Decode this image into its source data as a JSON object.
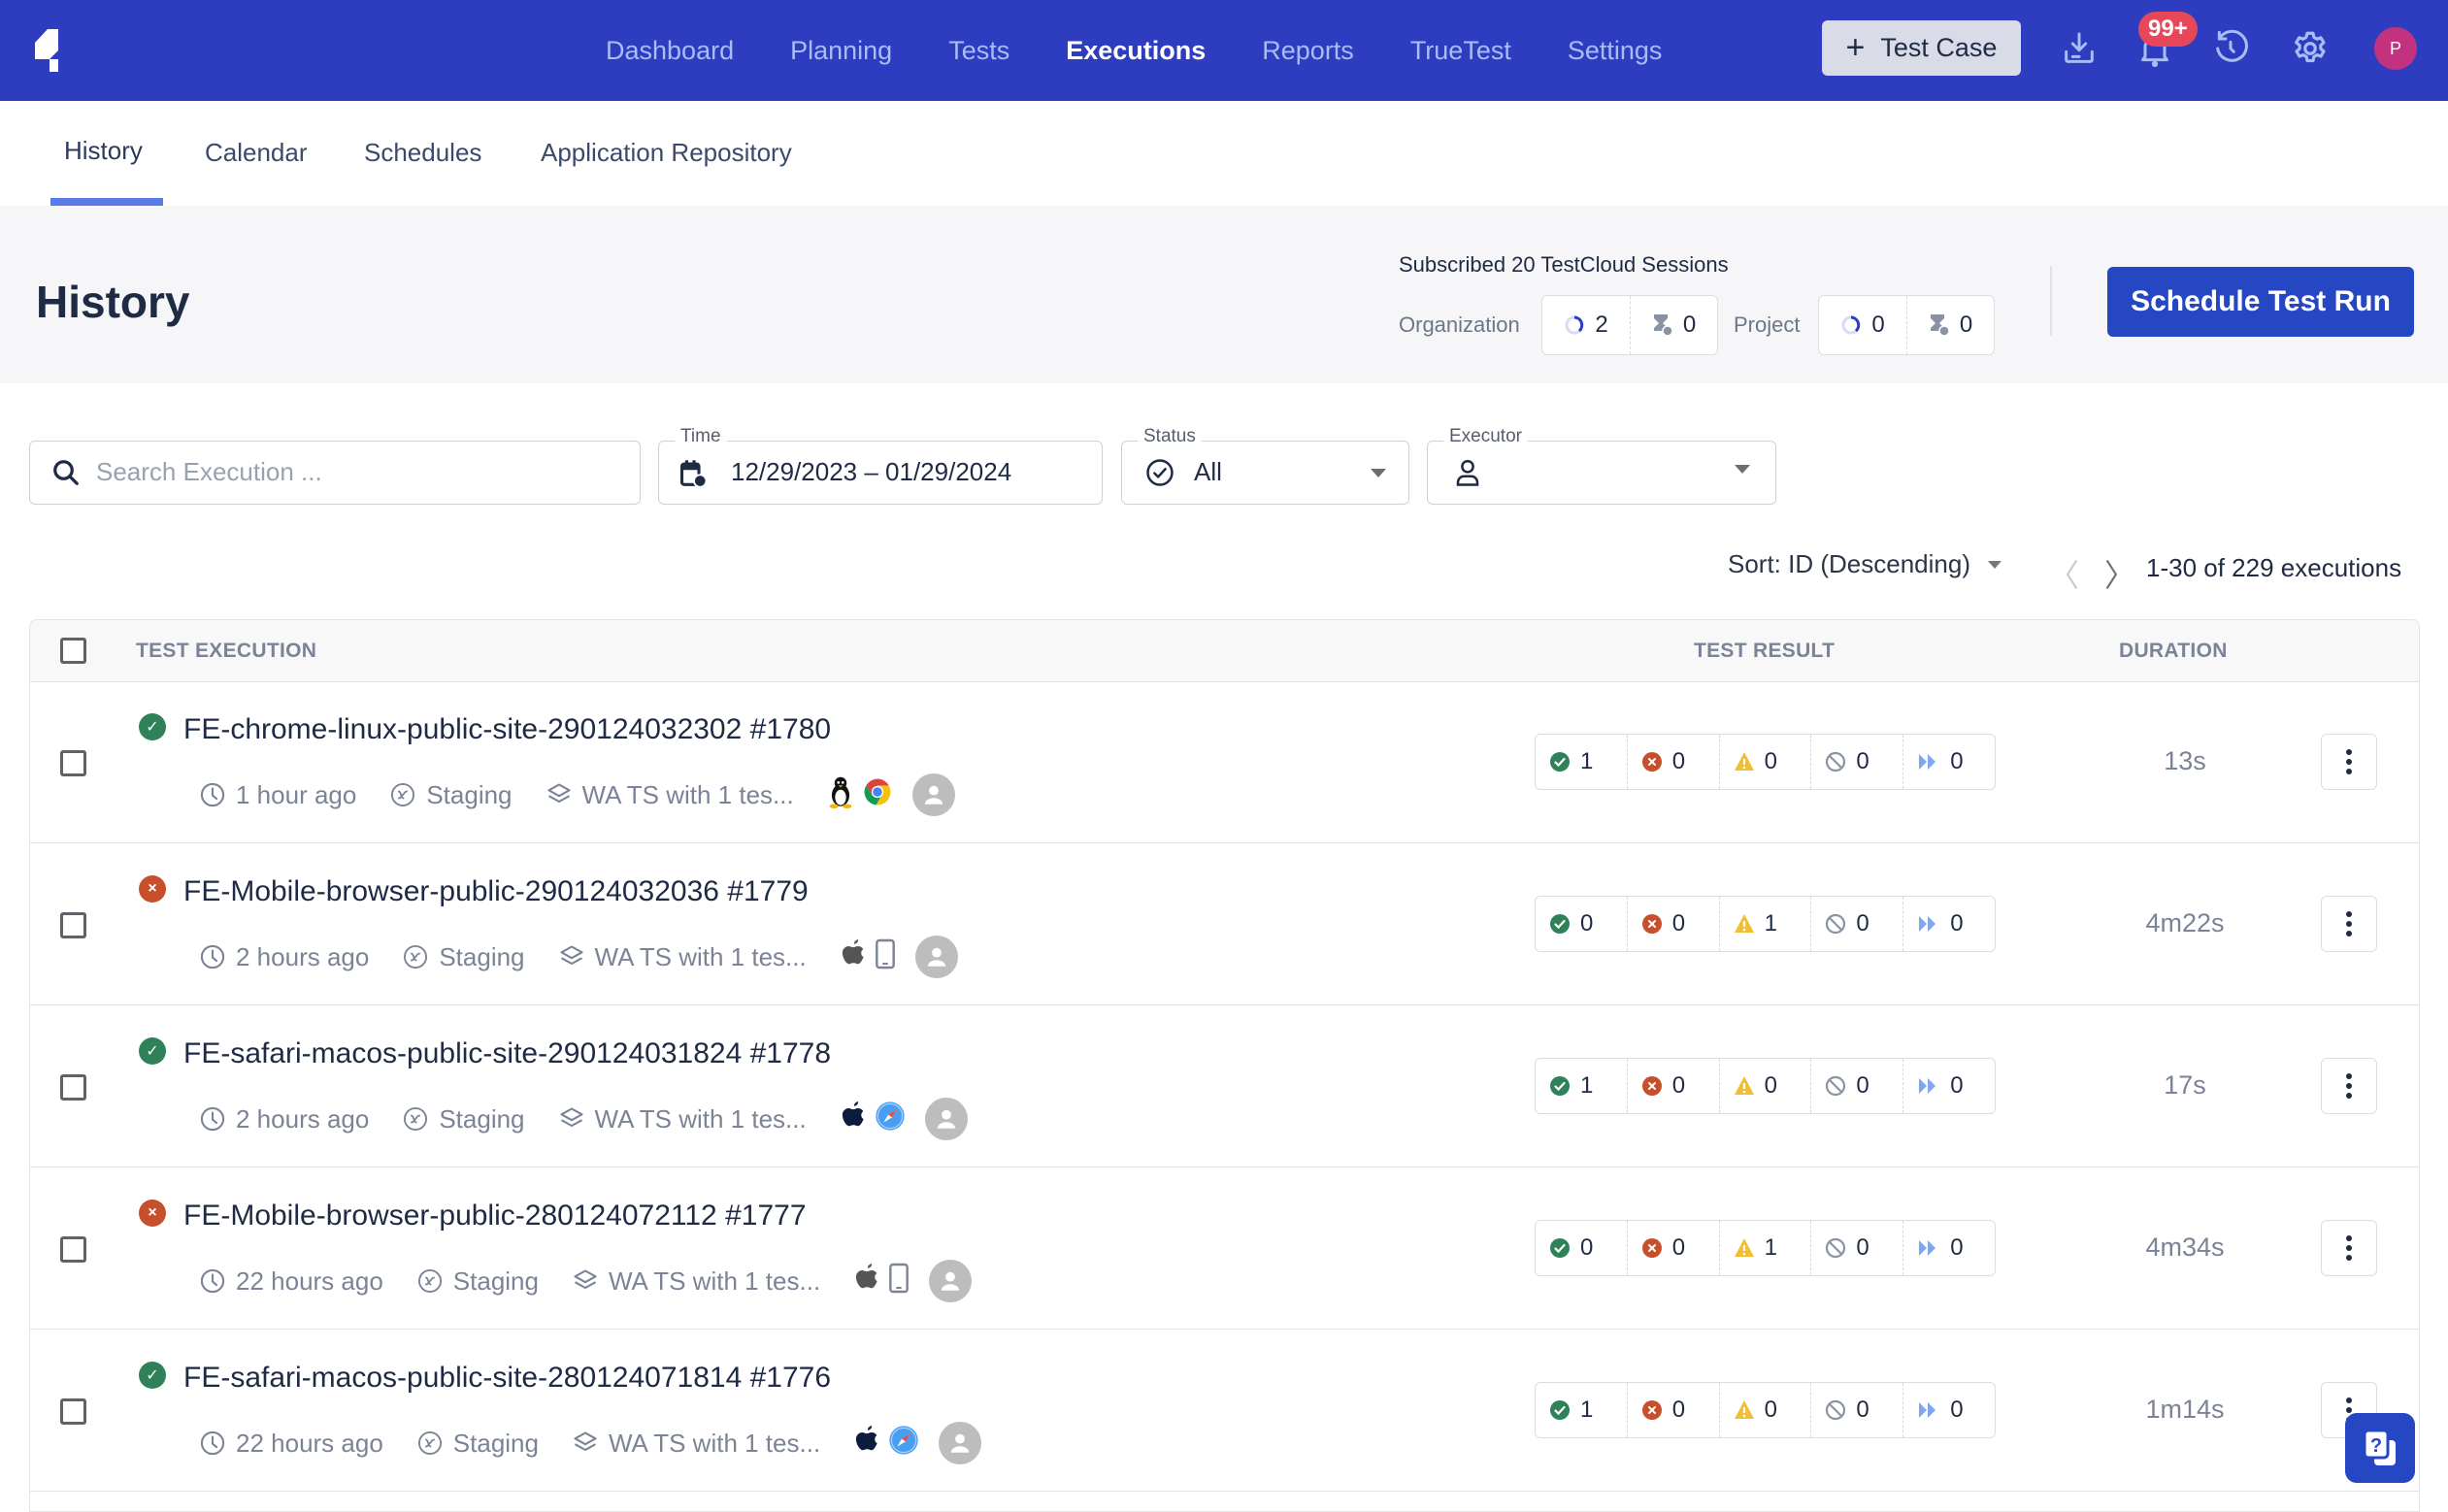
{
  "topbar": {
    "nav": [
      {
        "label": "Dashboard",
        "active": false
      },
      {
        "label": "Planning",
        "active": false
      },
      {
        "label": "Tests",
        "active": false
      },
      {
        "label": "Executions",
        "active": true
      },
      {
        "label": "Reports",
        "active": false
      },
      {
        "label": "TrueTest",
        "active": false
      },
      {
        "label": "Settings",
        "active": false
      }
    ],
    "test_case_button": "Test Case",
    "notification_badge": "99+",
    "avatar_initial": "P",
    "icons": [
      "download-icon",
      "bell-icon",
      "history-icon",
      "gear-icon"
    ]
  },
  "subtabs": [
    {
      "label": "History",
      "active": true
    },
    {
      "label": "Calendar",
      "active": false
    },
    {
      "label": "Schedules",
      "active": false
    },
    {
      "label": "Application Repository",
      "active": false
    }
  ],
  "header": {
    "title": "History",
    "subscribed": "Subscribed 20 TestCloud Sessions",
    "organization_label": "Organization",
    "organization_running": "2",
    "organization_queued": "0",
    "project_label": "Project",
    "project_running": "0",
    "project_queued": "0",
    "schedule_button": "Schedule Test Run"
  },
  "filters": {
    "search_placeholder": "Search Execution ...",
    "time_label": "Time",
    "time_value": "12/29/2023 – 01/29/2024",
    "status_label": "Status",
    "status_value": "All",
    "executor_label": "Executor",
    "executor_value": ""
  },
  "sorting": {
    "sort_label": "Sort: ID (Descending)",
    "pager_count": "1-30 of 229 executions"
  },
  "table": {
    "columns": {
      "execution": "TEST EXECUTION",
      "result": "TEST RESULT",
      "duration": "DURATION"
    },
    "rows": [
      {
        "status": "passed",
        "name": "FE-chrome-linux-public-site-290124032302 #1780",
        "time": "1 hour ago",
        "env": "Staging",
        "suite": "WA TS with 1 tes...",
        "platform": [
          "linux-icon",
          "chrome-icon"
        ],
        "passed": "1",
        "failed": "0",
        "error": "0",
        "incomplete": "0",
        "skipped": "0",
        "duration": "13s"
      },
      {
        "status": "failed",
        "name": "FE-Mobile-browser-public-290124032036 #1779",
        "time": "2 hours ago",
        "env": "Staging",
        "suite": "WA TS with 1 tes...",
        "platform": [
          "apple-icon",
          "mobile-icon"
        ],
        "passed": "0",
        "failed": "0",
        "error": "1",
        "incomplete": "0",
        "skipped": "0",
        "duration": "4m22s"
      },
      {
        "status": "passed",
        "name": "FE-safari-macos-public-site-290124031824 #1778",
        "time": "2 hours ago",
        "env": "Staging",
        "suite": "WA TS with 1 tes...",
        "platform": [
          "apple-icon",
          "safari-icon"
        ],
        "passed": "1",
        "failed": "0",
        "error": "0",
        "incomplete": "0",
        "skipped": "0",
        "duration": "17s"
      },
      {
        "status": "failed",
        "name": "FE-Mobile-browser-public-280124072112 #1777",
        "time": "22 hours ago",
        "env": "Staging",
        "suite": "WA TS with 1 tes...",
        "platform": [
          "apple-icon",
          "mobile-icon"
        ],
        "passed": "0",
        "failed": "0",
        "error": "1",
        "incomplete": "0",
        "skipped": "0",
        "duration": "4m34s"
      },
      {
        "status": "passed",
        "name": "FE-safari-macos-public-site-280124071814 #1776",
        "time": "22 hours ago",
        "env": "Staging",
        "suite": "WA TS with 1 tes...",
        "platform": [
          "apple-icon",
          "safari-icon"
        ],
        "passed": "1",
        "failed": "0",
        "error": "0",
        "incomplete": "0",
        "skipped": "0",
        "duration": "1m14s"
      }
    ]
  },
  "colors": {
    "brand": "#2e3dbf",
    "primary_button": "#2647c4",
    "passed": "#2f8159",
    "failed": "#c6502c",
    "error": "#f0bf35",
    "incomplete": "#8a93a3",
    "skipped": "#7fa6ef",
    "badge": "#e8475a"
  }
}
